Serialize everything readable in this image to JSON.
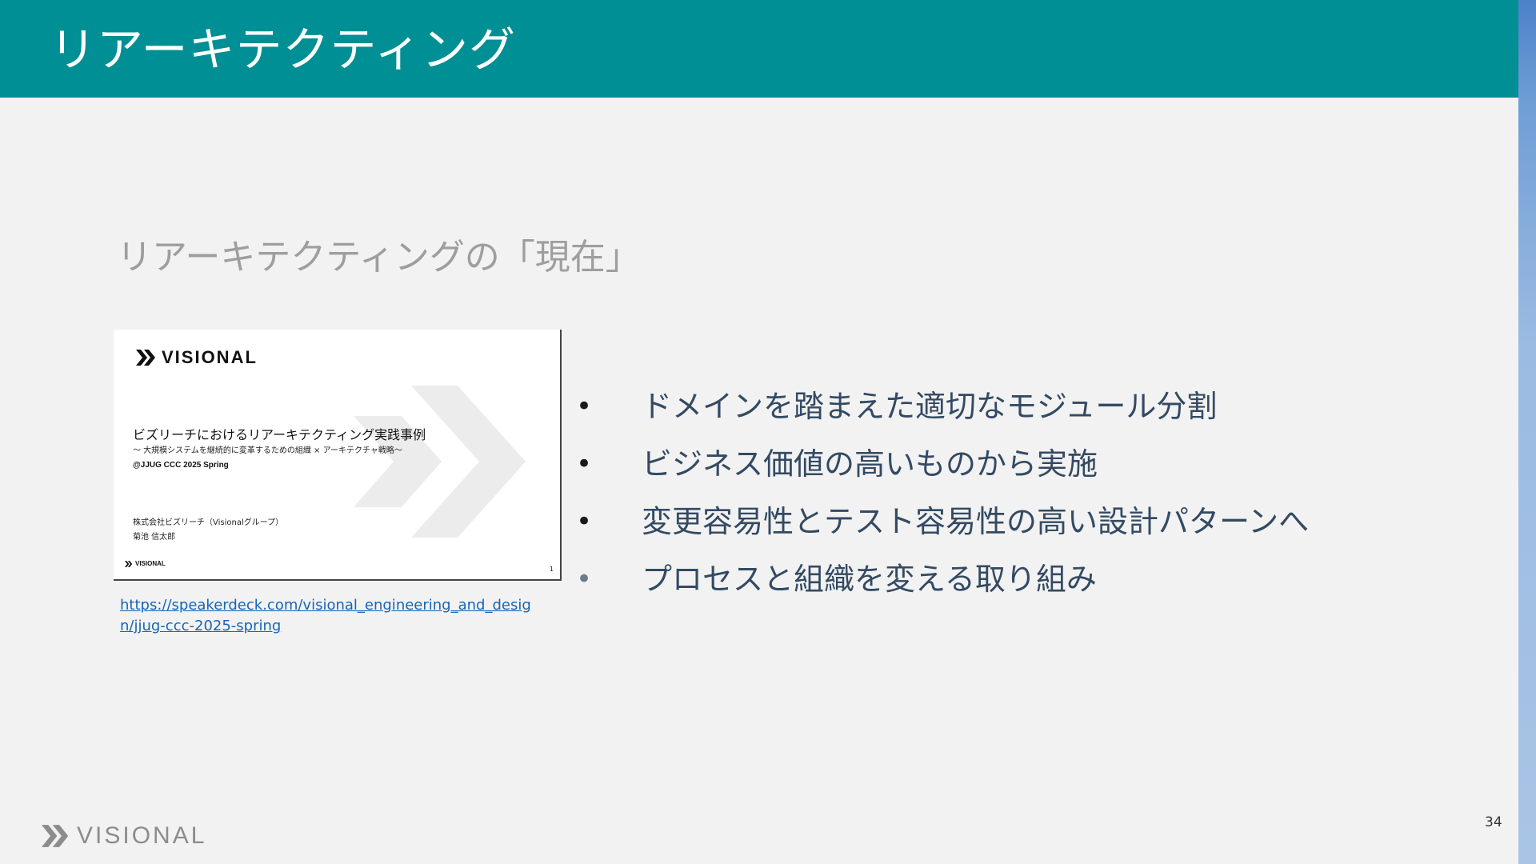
{
  "header": {
    "title": "リアーキテクティング"
  },
  "section": {
    "subtitle": "リアーキテクティングの「現在」"
  },
  "thumbnail": {
    "logo_text": "VISIONAL",
    "title": "ビズリーチにおけるリアーキテクティング実践事例",
    "subtitle": "〜 大規模システムを継続的に変革するための組織 × アーキテクチャ戦略〜",
    "event": "@JJUG CCC 2025 Spring",
    "company": "株式会社ビズリーチ（Visionalグループ）",
    "author": "菊池 信太郎",
    "footer_logo_text": "VISIONAL",
    "page": "1"
  },
  "link": {
    "text": "https://speakerdeck.com/visional_engineering_and_design/jjug-ccc-2025-spring"
  },
  "bullets": [
    {
      "text": "ドメインを踏まえた適切なモジュール分割"
    },
    {
      "text": "ビジネス価値の高いものから実施"
    },
    {
      "text": "変更容易性とテスト容易性の高い設計パターンへ"
    },
    {
      "text": "プロセスと組織を変える取り組み"
    }
  ],
  "bullet_symbol": "•",
  "footer": {
    "logo_text": "VISIONAL",
    "page_number": "34"
  },
  "colors": {
    "header": "#008f94",
    "background": "#f2f2f2",
    "link": "#1565b8",
    "bullet_text": "#344a63"
  }
}
